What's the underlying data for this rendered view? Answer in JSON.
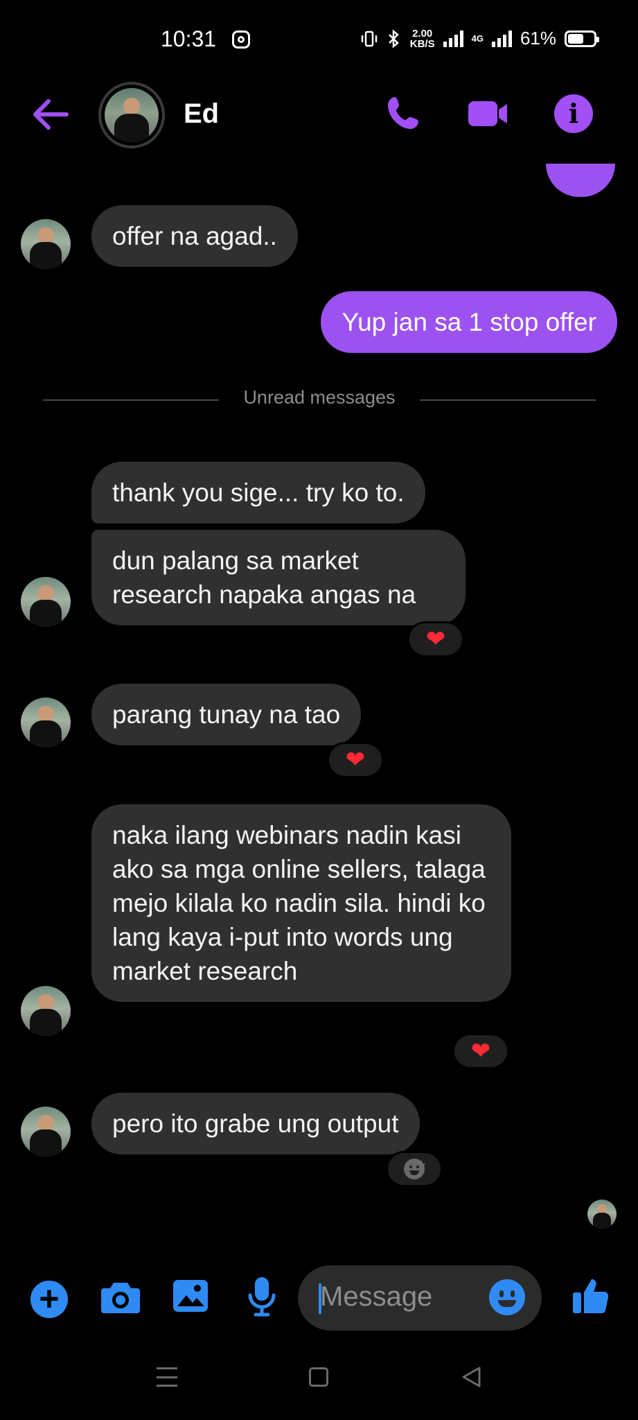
{
  "status_bar": {
    "time": "10:31",
    "speed_value": "2.00",
    "speed_unit": "KB/S",
    "network": "4G",
    "battery": "61%",
    "battery_level": 0.61
  },
  "header": {
    "contact_name": "Ed"
  },
  "divider": {
    "text": "Unread messages"
  },
  "messages": [
    {
      "text": "offer na agad..",
      "direction": "incoming"
    },
    {
      "text": "Yup jan sa 1 stop offer",
      "direction": "outgoing"
    },
    {
      "text": "thank you sige... try ko to.",
      "direction": "incoming"
    },
    {
      "text": "dun palang sa market research napaka angas na",
      "direction": "incoming",
      "reaction": "❤"
    },
    {
      "text": "parang tunay na tao",
      "direction": "incoming",
      "reaction": "❤"
    },
    {
      "text": "naka ilang webinars nadin kasi ako sa mga online sellers, talaga mejo kilala ko nadin sila. hindi ko lang kaya i-put into words ung market research",
      "direction": "incoming",
      "reaction": "❤"
    },
    {
      "text": "pero ito grabe ung output",
      "direction": "incoming",
      "reaction": "add-reaction"
    }
  ],
  "composer": {
    "placeholder": "Message"
  },
  "icons": {
    "back": "back-arrow-icon",
    "call": "phone-icon",
    "video": "video-camera-icon",
    "info": "info-icon",
    "add": "plus-icon",
    "camera": "camera-icon",
    "gallery": "image-icon",
    "mic": "microphone-icon",
    "emoji": "emoji-icon",
    "like": "thumbs-up-icon"
  },
  "colors": {
    "accent_purple": "#9c52f0",
    "accent_blue": "#2f8bf3",
    "incoming_bubble": "#303030",
    "background": "#000000"
  }
}
